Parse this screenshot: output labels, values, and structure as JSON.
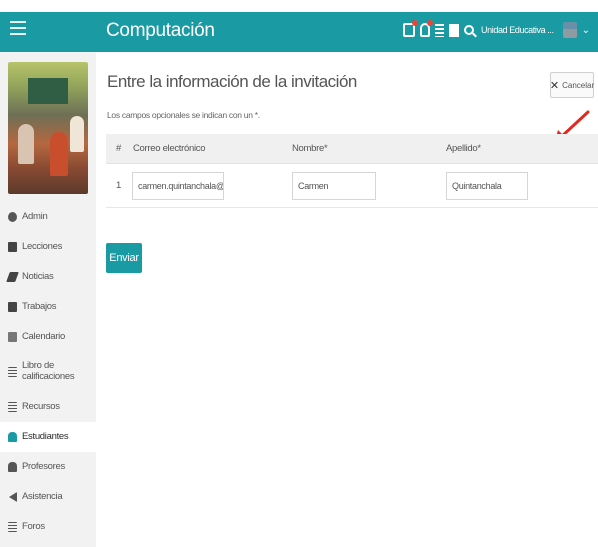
{
  "header": {
    "brand": "Computación",
    "school": "Unidad Educativa ..."
  },
  "sidebar": {
    "items": [
      {
        "label": "Admin",
        "icon": "gear-icon"
      },
      {
        "label": "Lecciones",
        "icon": "book-icon"
      },
      {
        "label": "Noticias",
        "icon": "pen-icon"
      },
      {
        "label": "Trabajos",
        "icon": "edit-icon"
      },
      {
        "label": "Calendario",
        "icon": "calendar-icon"
      },
      {
        "label": "Libro de calificaciones",
        "icon": "gradebook-icon"
      },
      {
        "label": "Recursos",
        "icon": "resources-icon"
      },
      {
        "label": "Estudiantes",
        "icon": "student-icon",
        "active": true
      },
      {
        "label": "Profesores",
        "icon": "teacher-icon"
      },
      {
        "label": "Asistencia",
        "icon": "attendance-icon"
      },
      {
        "label": "Foros",
        "icon": "forum-icon"
      }
    ]
  },
  "main": {
    "title": "Entre la información de la invitación",
    "hint": "Los campos opcionales se indican con un *.",
    "cancel_label": "Cancelar",
    "table": {
      "headers": [
        "#",
        "Correo electrónico",
        "Nombre*",
        "Apellido*"
      ],
      "rows": [
        {
          "num": "1",
          "email": "carmen.quintanchala@gm...",
          "first_name": "Carmen",
          "last_name": "Quintanchala"
        }
      ]
    },
    "submit_label": "Enviar"
  },
  "colors": {
    "accent": "#1a9aa3",
    "annotation_arrow": "#e02a20"
  }
}
